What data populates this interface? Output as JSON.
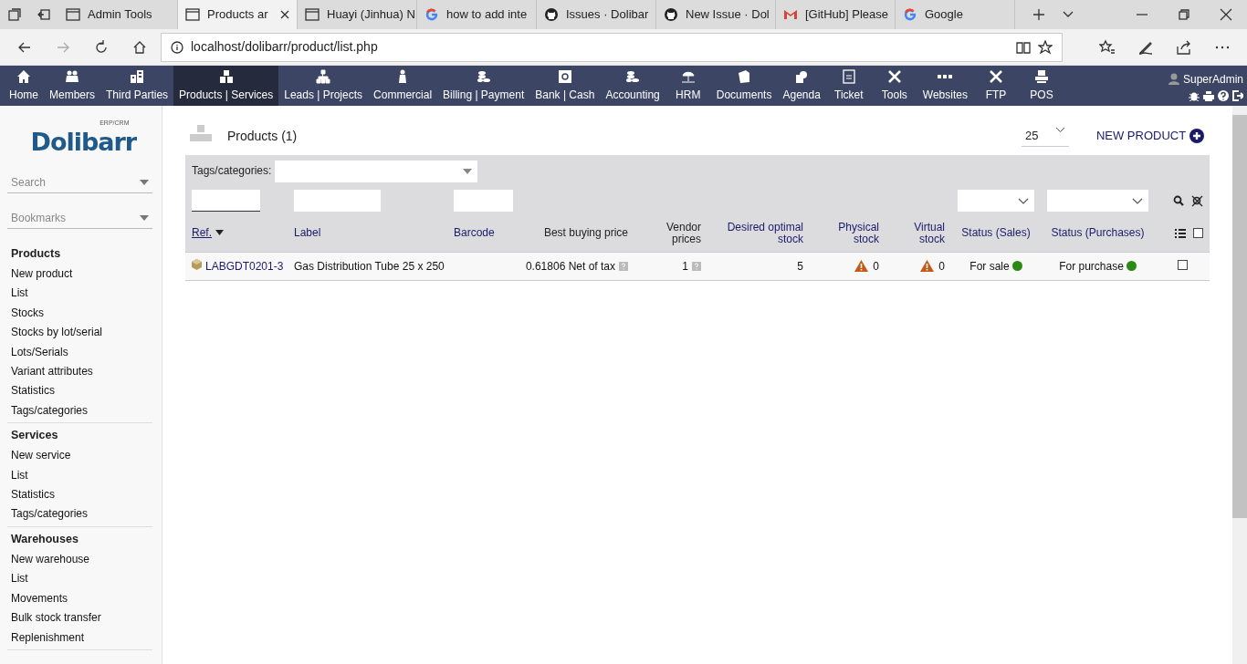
{
  "browser": {
    "tabs": [
      {
        "title": "Admin Tools",
        "kind": "page",
        "selected": false
      },
      {
        "title": "Products ar",
        "kind": "page",
        "selected": true
      },
      {
        "title": "Huayi (Jinhua) N",
        "kind": "page",
        "selected": false
      },
      {
        "title": "how to add inte",
        "kind": "google",
        "selected": false
      },
      {
        "title": "Issues · Dolibar",
        "kind": "github",
        "selected": false
      },
      {
        "title": "New Issue · Dol",
        "kind": "github",
        "selected": false
      },
      {
        "title": "[GitHub] Please",
        "kind": "mail",
        "selected": false
      },
      {
        "title": "Google",
        "kind": "google",
        "selected": false
      }
    ],
    "address": "localhost/dolibarr/product/list.php"
  },
  "topmenu": {
    "items": [
      {
        "label": "Home",
        "selected": false
      },
      {
        "label": "Members",
        "selected": false
      },
      {
        "label": "Third Parties",
        "selected": false
      },
      {
        "label": "Products | Services",
        "selected": true
      },
      {
        "label": "Leads | Projects",
        "selected": false
      },
      {
        "label": "Commercial",
        "selected": false
      },
      {
        "label": "Billing | Payment",
        "selected": false
      },
      {
        "label": "Bank | Cash",
        "selected": false
      },
      {
        "label": "Accounting",
        "selected": false
      },
      {
        "label": "HRM",
        "selected": false
      },
      {
        "label": "Documents",
        "selected": false
      },
      {
        "label": "Agenda",
        "selected": false
      },
      {
        "label": "Ticket",
        "selected": false
      },
      {
        "label": "Tools",
        "selected": false
      },
      {
        "label": "Websites",
        "selected": false
      },
      {
        "label": "FTP",
        "selected": false
      },
      {
        "label": "POS",
        "selected": false
      }
    ],
    "user": "SuperAdmin"
  },
  "sidebar": {
    "logo": "Dolibarr",
    "logo_tag": "ERP/CRM",
    "search": {
      "placeholder": "Search"
    },
    "bookmarks": {
      "placeholder": "Bookmarks"
    },
    "sections": [
      {
        "title": "Products",
        "items": [
          "New product",
          "List",
          "Stocks",
          "Stocks by lot/serial",
          "Lots/Serials",
          "Variant attributes",
          "Statistics",
          "Tags/categories"
        ]
      },
      {
        "title": "Services",
        "items": [
          "New service",
          "List",
          "Statistics",
          "Tags/categories"
        ]
      },
      {
        "title": "Warehouses",
        "items": [
          "New warehouse",
          "List",
          "Movements",
          "Bulk stock transfer",
          "Replenishment"
        ]
      }
    ]
  },
  "main": {
    "title": "Products (1)",
    "page_size": "25",
    "new_button": "NEW PRODUCT",
    "filter_label": "Tags/categories:",
    "select_all": false,
    "columns": [
      {
        "label": "Ref.",
        "sorted": true
      },
      {
        "label": "Label",
        "sorted": false
      },
      {
        "label": "Barcode",
        "sorted": false
      },
      {
        "label": "Best buying price",
        "sorted": false
      },
      {
        "label": "Vendor prices",
        "sorted": false
      },
      {
        "label": "Desired optimal stock",
        "sorted": false
      },
      {
        "label": "Physical stock",
        "sorted": false
      },
      {
        "label": "Virtual stock",
        "sorted": false
      },
      {
        "label": "Status (Sales)",
        "sorted": false
      },
      {
        "label": "Status (Purchases)",
        "sorted": false
      }
    ],
    "rows": [
      {
        "ref": "LABGDT0201-3",
        "label": "Gas Distribution Tube 25 x 250",
        "best_price": "0.61806 Net of tax",
        "vendor_prices": "1",
        "desired_stock": "5",
        "physical_stock": {
          "value": "0",
          "warning": true
        },
        "virtual_stock": {
          "value": "0",
          "warning": true
        },
        "status_sales": {
          "text": "For sale",
          "on": true
        },
        "status_purchases": {
          "text": "For purchase",
          "on": true
        },
        "selected": false
      }
    ]
  }
}
